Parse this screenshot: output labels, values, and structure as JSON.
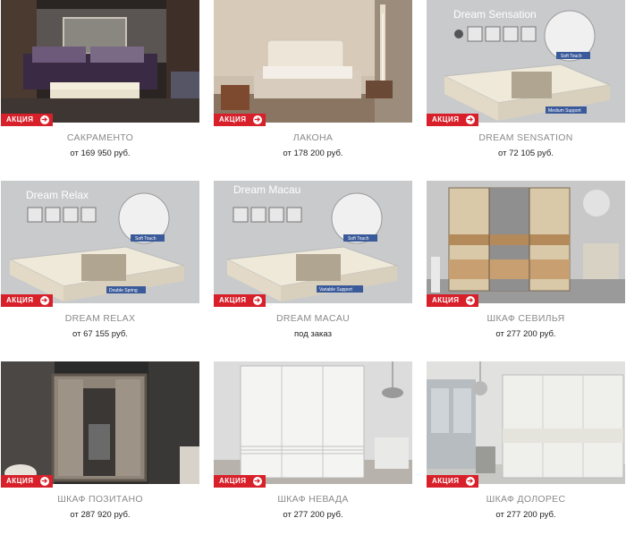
{
  "badge_label": "АКЦИЯ",
  "colors": {
    "badge": "#d8202a",
    "name_text": "#8a8a8a",
    "price_text": "#222222"
  },
  "products": [
    {
      "name": "САКРАМЕНТО",
      "price": "от 169 950 руб.",
      "badge": true
    },
    {
      "name": "ЛАКОНА",
      "price": "от 178 200 руб.",
      "badge": true
    },
    {
      "name": "DREAM SENSATION",
      "price": "от 72 105 руб.",
      "badge": true,
      "image_title": "Dream Sensation",
      "image_callouts": [
        "Soft Touch",
        "Medium Support"
      ]
    },
    {
      "name": "DREAM RELAX",
      "price": "от 67 155 руб.",
      "badge": true,
      "image_title": "Dream Relax",
      "image_callouts": [
        "Soft Touch",
        "Double Spring"
      ]
    },
    {
      "name": "DREAM MACAU",
      "price": "под заказ",
      "badge": true,
      "image_title": "Dream Macau",
      "image_callouts": [
        "Soft Touch",
        "Variable Support"
      ]
    },
    {
      "name": "ШКАФ СЕВИЛЬЯ",
      "price": "от 277 200 руб.",
      "badge": true
    },
    {
      "name": "ШКАФ ПОЗИТАНО",
      "price": "от 287 920 руб.",
      "badge": true
    },
    {
      "name": "ШКАФ НЕВАДА",
      "price": "от 277 200 руб.",
      "badge": true
    },
    {
      "name": "ШКАФ ДОЛОРЕС",
      "price": "от 277 200 руб.",
      "badge": true
    }
  ]
}
